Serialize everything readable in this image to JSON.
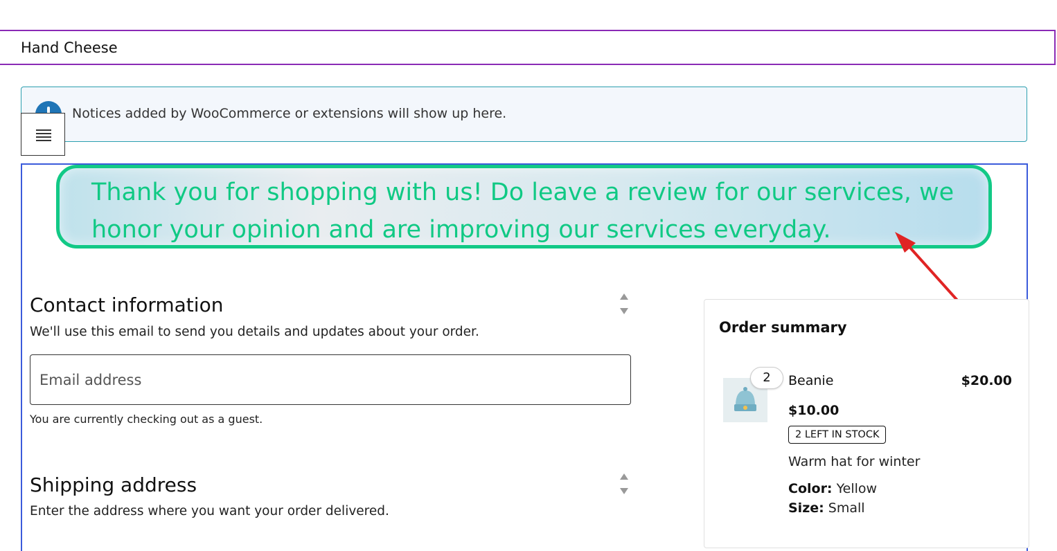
{
  "site": {
    "title": "Hand Cheese"
  },
  "notice": {
    "text": "Notices added by WooCommerce or extensions will show up here.",
    "icon": "info-icon"
  },
  "menu": {
    "icon": "hamburger-menu-icon"
  },
  "banner": {
    "text": "Thank you for shopping with us! Do leave a review for our services, we honor your opinion and are improving our services everyday.",
    "text_color": "#10c984",
    "border_color": "#12c986"
  },
  "annotation": {
    "icon": "red-arrow-icon",
    "color": "#e02424"
  },
  "contact": {
    "title": "Contact information",
    "description": "We'll use this email to send you details and updates about your order.",
    "email_placeholder": "Email address",
    "email_value": "",
    "guest_note": "You are currently checking out as a guest."
  },
  "shipping": {
    "title": "Shipping address",
    "description": "Enter the address where you want your order delivered."
  },
  "order_summary": {
    "title": "Order summary",
    "items": [
      {
        "name": "Beanie",
        "quantity": "2",
        "total": "$20.00",
        "price": "$10.00",
        "stock": "2 LEFT IN STOCK",
        "description": "Warm hat for winter",
        "meta": [
          {
            "label": "Color:",
            "value": "Yellow"
          },
          {
            "label": "Size:",
            "value": "Small"
          }
        ]
      }
    ]
  }
}
